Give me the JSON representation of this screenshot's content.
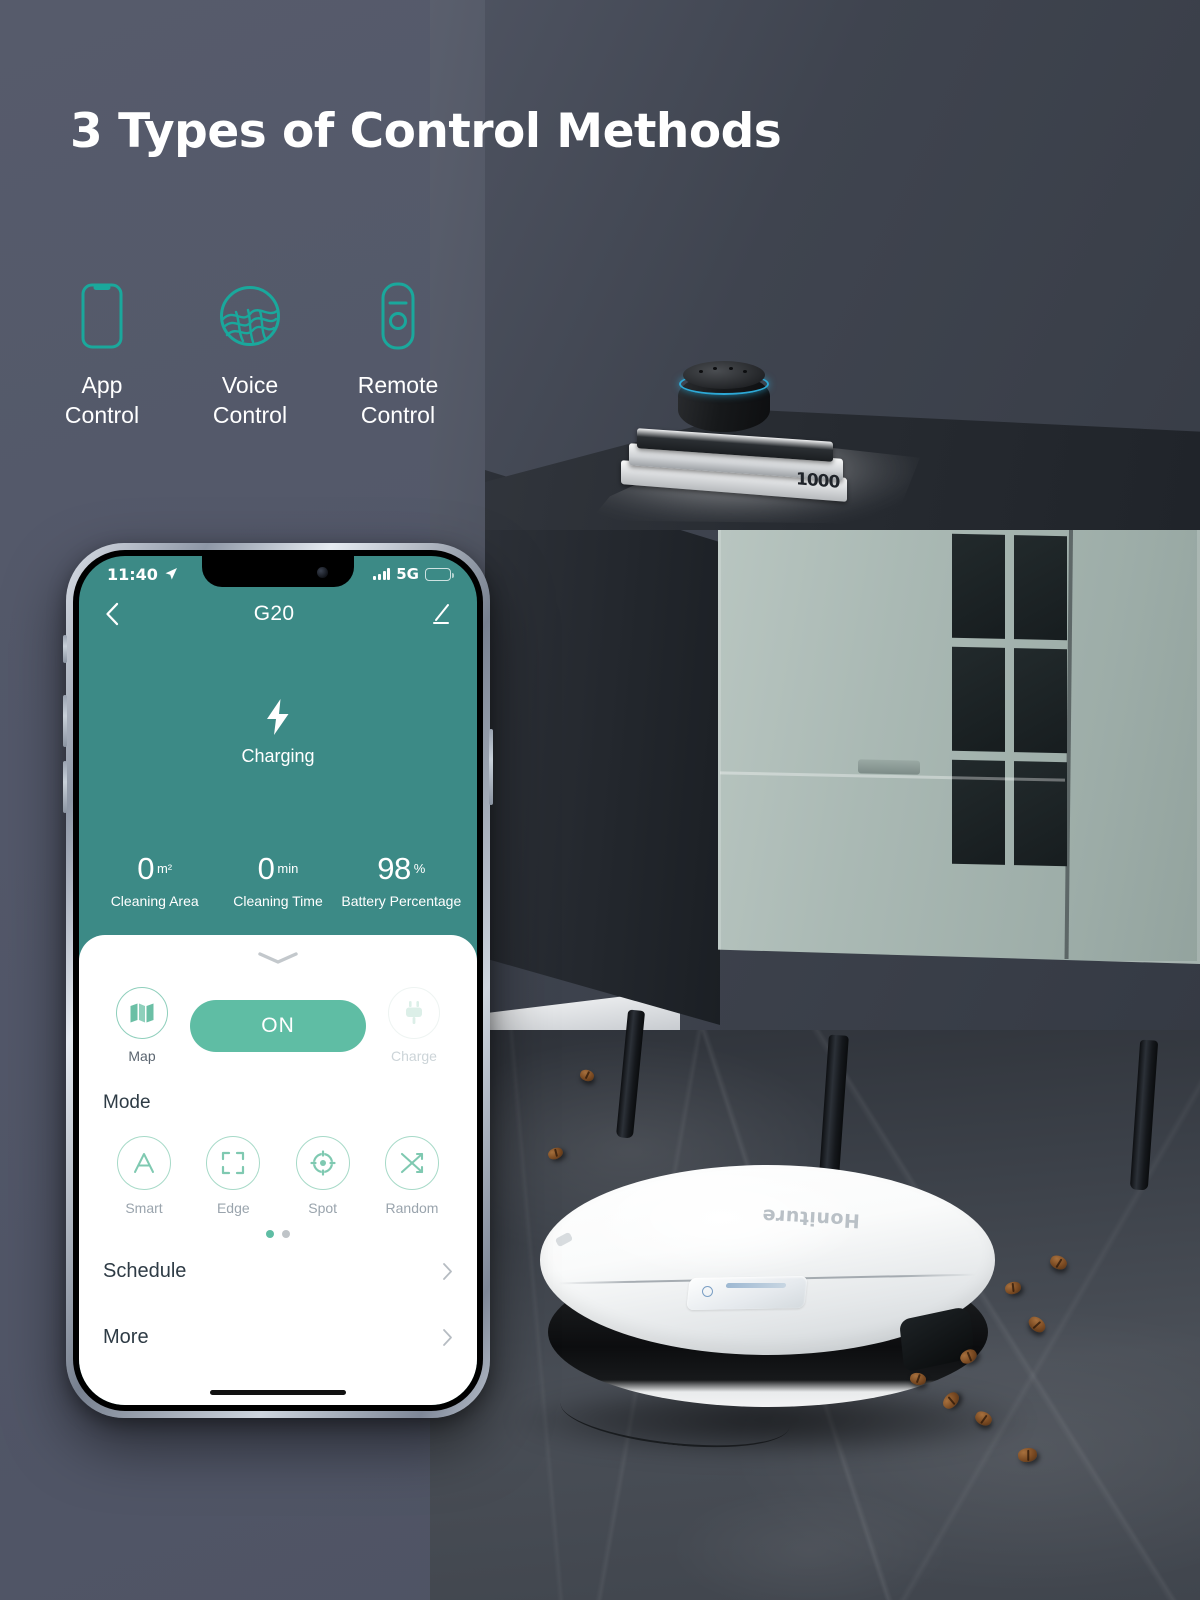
{
  "headline": "3 Types of Control Methods",
  "colors": {
    "background": "#535868",
    "accent_teal": "#3c8a86",
    "accent_mint": "#5fbda4",
    "icon_teal": "#1aa89c",
    "battery_low": "#f04a3a"
  },
  "methods": [
    {
      "icon": "phone-icon",
      "label": "App\nControl",
      "line1": "App",
      "line2": "Control"
    },
    {
      "icon": "voice-wave-icon",
      "label": "Voice\nControl",
      "line1": "Voice",
      "line2": "Control"
    },
    {
      "icon": "remote-icon",
      "label": "Remote\nControl",
      "line1": "Remote",
      "line2": "Control"
    }
  ],
  "phone": {
    "status_bar": {
      "time": "11:40",
      "location_icon": "location-arrow-icon",
      "signal_icon": "signal-bars-icon",
      "network": "5G",
      "battery_icon": "battery-low-icon"
    },
    "app_header": {
      "back_icon": "chevron-left-icon",
      "title": "G20",
      "edit_icon": "edit-pencil-icon"
    },
    "hero": {
      "status_icon": "lightning-bolt-icon",
      "status_text": "Charging"
    },
    "stats": [
      {
        "value": "0",
        "unit": "m²",
        "label": "Cleaning Area"
      },
      {
        "value": "0",
        "unit": "min",
        "label": "Cleaning Time"
      },
      {
        "value": "98",
        "unit": "%",
        "label": "Battery Percentage"
      }
    ],
    "sheet": {
      "grabber_icon": "chevron-down-icon",
      "quick_actions": {
        "map": {
          "icon": "map-icon",
          "label": "Map",
          "enabled": true
        },
        "power": {
          "label": "ON"
        },
        "charge": {
          "icon": "plug-icon",
          "label": "Charge",
          "enabled": false
        }
      },
      "mode_section_title": "Mode",
      "modes": [
        {
          "icon": "letter-a-icon",
          "label": "Smart"
        },
        {
          "icon": "brackets-icon",
          "label": "Edge"
        },
        {
          "icon": "crosshair-icon",
          "label": "Spot"
        },
        {
          "icon": "shuffle-icon",
          "label": "Random"
        }
      ],
      "page_dots": {
        "count": 2,
        "active_index": 0
      },
      "list_rows": [
        {
          "label": "Schedule",
          "chevron": "chevron-right-icon"
        },
        {
          "label": "More",
          "chevron": "chevron-right-icon"
        }
      ]
    }
  },
  "scene": {
    "smart_speaker": "smart-speaker",
    "book_number": "1000",
    "robot_brand": "Honiture",
    "sideboard": "sideboard-cabinet"
  }
}
